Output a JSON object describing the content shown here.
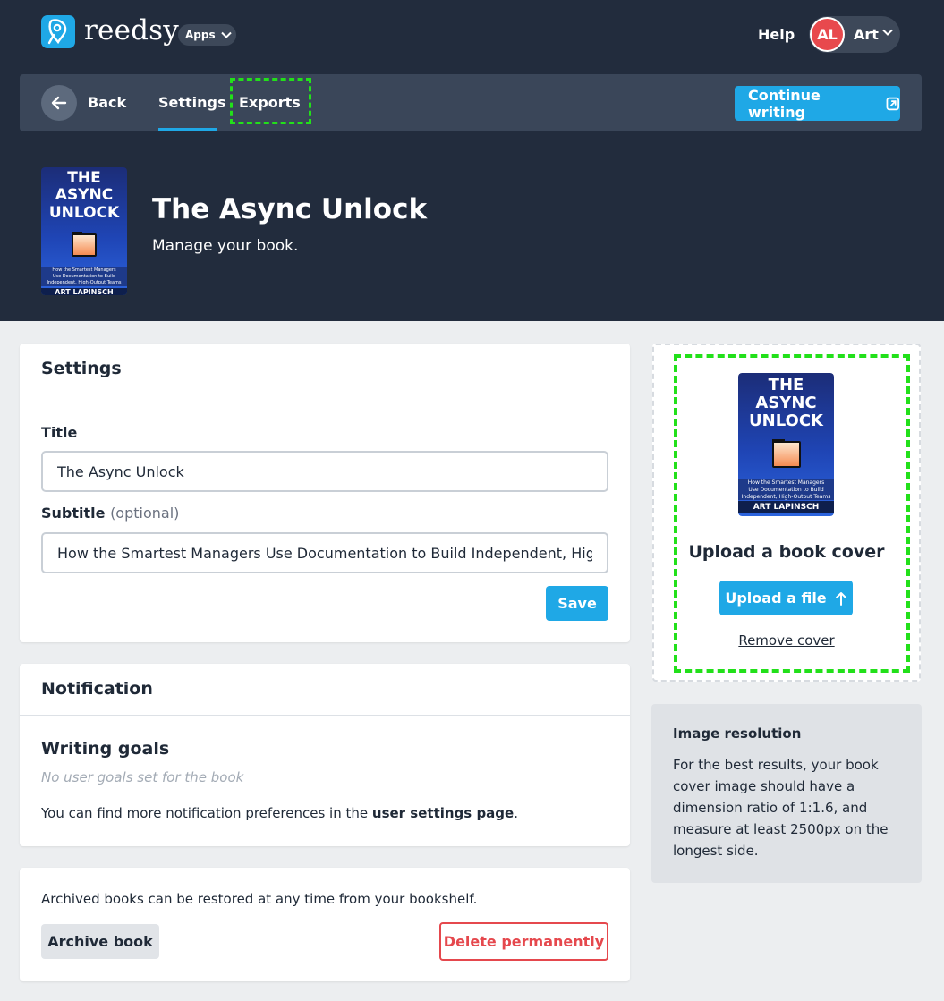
{
  "brand": {
    "name": "reedsy",
    "apps_label": "Apps"
  },
  "topbar": {
    "help_label": "Help",
    "user": {
      "initials": "AL",
      "name": "Art"
    }
  },
  "nav": {
    "back_label": "Back",
    "tabs": [
      {
        "label": "Settings",
        "active": true
      },
      {
        "label": "Exports",
        "active": false
      }
    ],
    "continue_label": "Continue writing"
  },
  "book": {
    "title": "The Async Unlock",
    "manage_text": "Manage your book.",
    "cover": {
      "title_lines": [
        "THE",
        "ASYNC",
        "UNLOCK"
      ],
      "tagline_lines": [
        "How the Smartest Managers",
        "Use Documentation to Build",
        "Independent, High-Output Teams"
      ],
      "author": "ART LAPINSCH"
    }
  },
  "settings": {
    "heading": "Settings",
    "title_label": "Title",
    "title_value": "The Async Unlock",
    "subtitle_label": "Subtitle",
    "subtitle_optional": "(optional)",
    "subtitle_value": "How the Smartest Managers Use Documentation to Build Independent, High-Output Teams",
    "save_label": "Save"
  },
  "notification": {
    "heading": "Notification",
    "goals_title": "Writing goals",
    "goals_empty": "No user goals set for the book",
    "prefs_text": "You can find more notification preferences in the ",
    "prefs_link": "user settings page",
    "prefs_end": "."
  },
  "archive": {
    "text": "Archived books can be restored at any time from your bookshelf.",
    "archive_label": "Archive book",
    "delete_label": "Delete permanently"
  },
  "cover_upload": {
    "title": "Upload a book cover",
    "upload_label": "Upload a file",
    "remove_label": "Remove cover"
  },
  "image_info": {
    "title": "Image resolution",
    "body": "For the best results, your book cover image should have a dimension ratio of 1:1.6, and measure at least 2500px on the longest side."
  },
  "colors": {
    "header_bg": "#222c3d",
    "navbar_bg": "#3a4659",
    "accent": "#1fa8e6",
    "danger": "#e5484d",
    "highlight": "#22e01a",
    "page_bg": "#eceef0"
  }
}
